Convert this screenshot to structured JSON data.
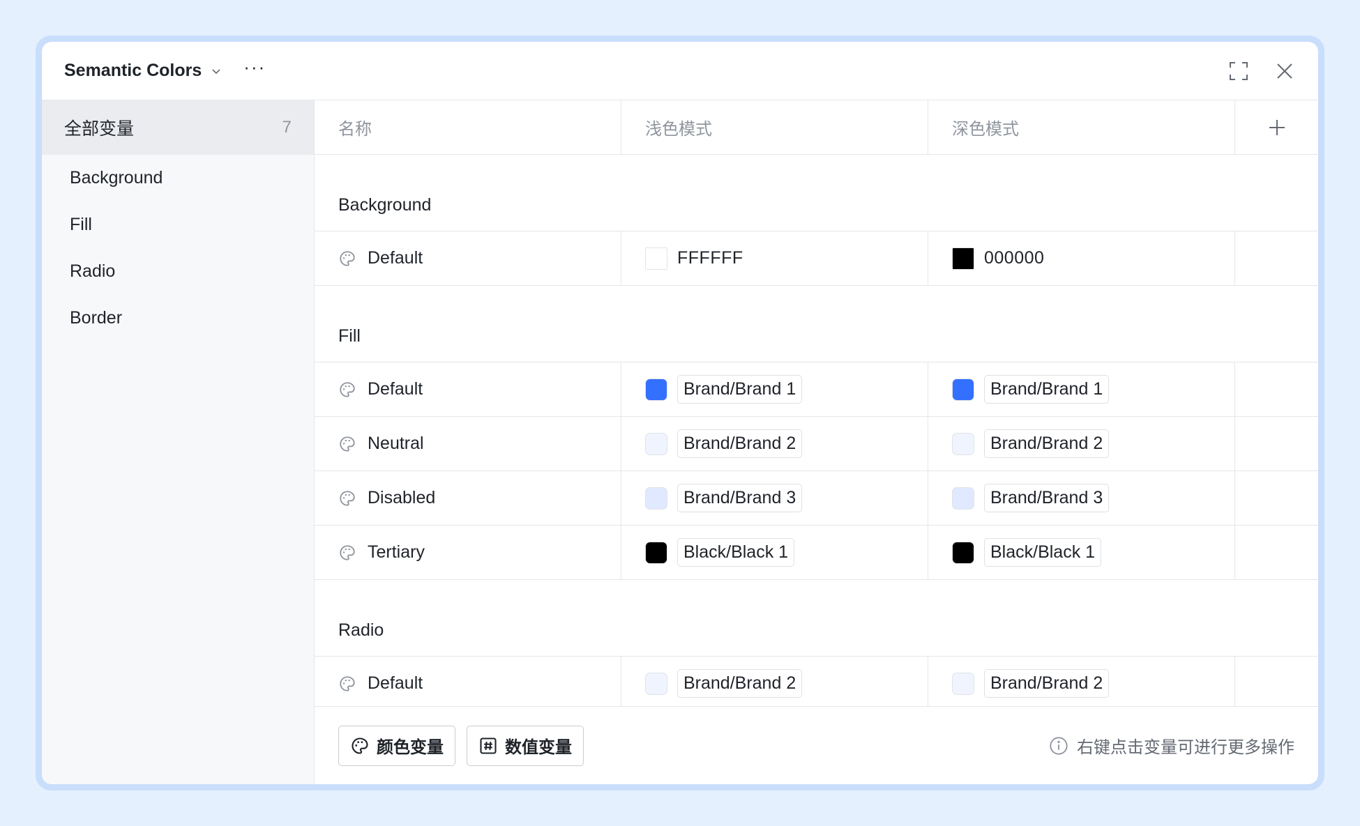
{
  "window": {
    "title": "Semantic Colors",
    "more_label": "···"
  },
  "sidebar": {
    "all": {
      "label": "全部变量",
      "count": "7"
    },
    "items": [
      {
        "label": "Background"
      },
      {
        "label": "Fill"
      },
      {
        "label": "Radio"
      },
      {
        "label": "Border"
      }
    ]
  },
  "table": {
    "headers": {
      "name": "名称",
      "light": "浅色模式",
      "dark": "深色模式"
    },
    "groups": [
      {
        "title": "Background",
        "rows": [
          {
            "name": "Default",
            "light": {
              "value": "FFFFFF",
              "color": "#FFFFFF"
            },
            "dark": {
              "value": "000000",
              "color": "#000000"
            }
          }
        ]
      },
      {
        "title": "Fill",
        "rows": [
          {
            "name": "Default",
            "light": {
              "value": "Brand/Brand 1",
              "color": "#3370FF"
            },
            "dark": {
              "value": "Brand/Brand 1",
              "color": "#3370FF"
            }
          },
          {
            "name": "Neutral",
            "light": {
              "value": "Brand/Brand 2",
              "color": "#F0F4FF"
            },
            "dark": {
              "value": "Brand/Brand 2",
              "color": "#F0F4FF"
            }
          },
          {
            "name": "Disabled",
            "light": {
              "value": "Brand/Brand 3",
              "color": "#E0E9FF"
            },
            "dark": {
              "value": "Brand/Brand 3",
              "color": "#E0E9FF"
            }
          },
          {
            "name": "Tertiary",
            "light": {
              "value": "Black/Black 1",
              "color": "#000000"
            },
            "dark": {
              "value": "Black/Black 1",
              "color": "#000000"
            }
          }
        ]
      },
      {
        "title": "Radio",
        "rows": [
          {
            "name": "Default",
            "light": {
              "value": "Brand/Brand 2",
              "color": "#F0F4FF"
            },
            "dark": {
              "value": "Brand/Brand 2",
              "color": "#F0F4FF"
            }
          }
        ]
      }
    ]
  },
  "footer": {
    "color_var_label": "颜色变量",
    "number_var_label": "数值变量",
    "hint": "右键点击变量可进行更多操作"
  },
  "colors": {
    "page_bg": "#E5F0FE",
    "frame": "#C9DEFB",
    "sidebar_bg": "#F7F8FA",
    "sidebar_active": "#EBECEF",
    "accent": "#3370FF"
  },
  "icons": {
    "chevron": "chevron-down-icon",
    "more": "more-horizontal-icon",
    "maximize": "maximize-icon",
    "close": "close-icon",
    "add": "plus-icon",
    "color_variable": "palette-icon",
    "number_variable": "hash-icon",
    "info": "info-icon"
  }
}
